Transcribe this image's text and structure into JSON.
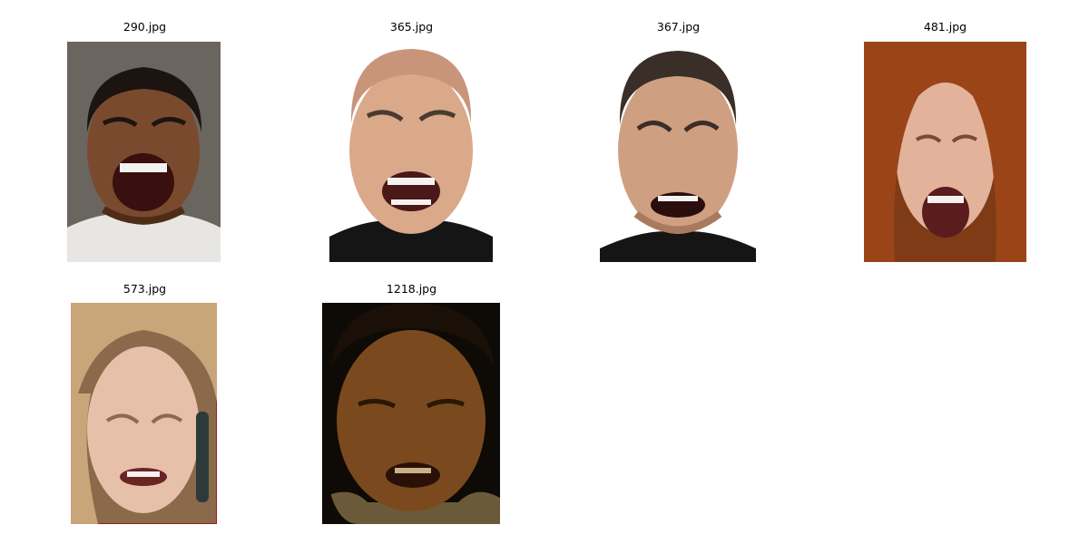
{
  "figure": {
    "images": [
      {
        "title": "290.jpg",
        "palette": {
          "bg": "#6b6560",
          "skin": "#7a4a2e",
          "skin_dark": "#4e2c18",
          "hair": "#1c1410",
          "shirt": "#e8e6e2",
          "mouth": "#3a0f0f"
        }
      },
      {
        "title": "365.jpg",
        "palette": {
          "bg": "#ffffff",
          "skin": "#d9a98a",
          "skin_dark": "#b88063",
          "hair": "#4a3a30",
          "shirt": "#151515",
          "mouth": "#4a1818"
        }
      },
      {
        "title": "367.jpg",
        "palette": {
          "bg": "#ffffff",
          "skin": "#cf9f82",
          "skin_dark": "#a97a5e",
          "hair": "#3a2e28",
          "shirt": "#151515",
          "mouth": "#2a0e0e"
        }
      },
      {
        "title": "481.jpg",
        "palette": {
          "bg": "#7f3a16",
          "skin": "#e2b29a",
          "skin_dark": "#c48e74",
          "hair": "#9a4418",
          "shirt": "#b88a6e",
          "mouth": "#5a1c1c"
        }
      },
      {
        "title": "573.jpg",
        "palette": {
          "bg": "#8a6a4a",
          "skin": "#e6c0a8",
          "skin_dark": "#c89a80",
          "hair": "#c9a57a",
          "shirt": "#d8b89c",
          "mouth": "#6a2424"
        }
      },
      {
        "title": "1218.jpg",
        "palette": {
          "bg": "#0e0a06",
          "skin": "#7a4a1e",
          "skin_dark": "#4a2a10",
          "hair": "#1a1008",
          "shirt": "#6a5a3a",
          "mouth": "#2a1006"
        }
      }
    ]
  }
}
